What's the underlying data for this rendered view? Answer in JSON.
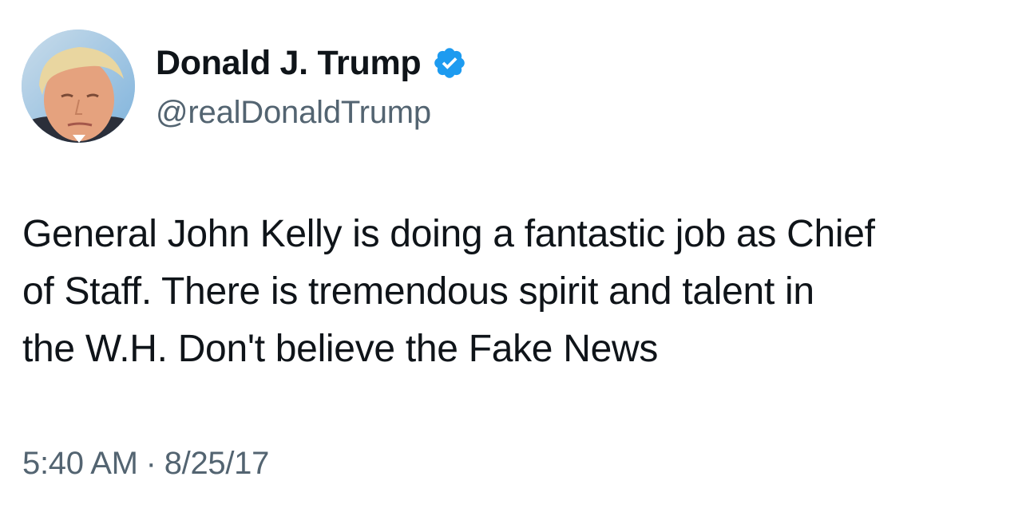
{
  "author": {
    "display_name": "Donald J. Trump",
    "handle": "@realDonaldTrump",
    "verified": true,
    "avatar_icon": "profile-photo",
    "verified_icon": "verified-badge-icon",
    "verified_color": "#1d9bf0"
  },
  "tweet": {
    "text": "General John Kelly is doing a fantastic job as Chief\nof Staff. There is tremendous spirit and talent in\nthe W.H. Don't believe the Fake News"
  },
  "meta": {
    "time": "5:40 AM",
    "separator": "·",
    "date": "8/25/17"
  },
  "colors": {
    "text": "#0f1419",
    "secondary": "#536471",
    "background": "#ffffff"
  }
}
